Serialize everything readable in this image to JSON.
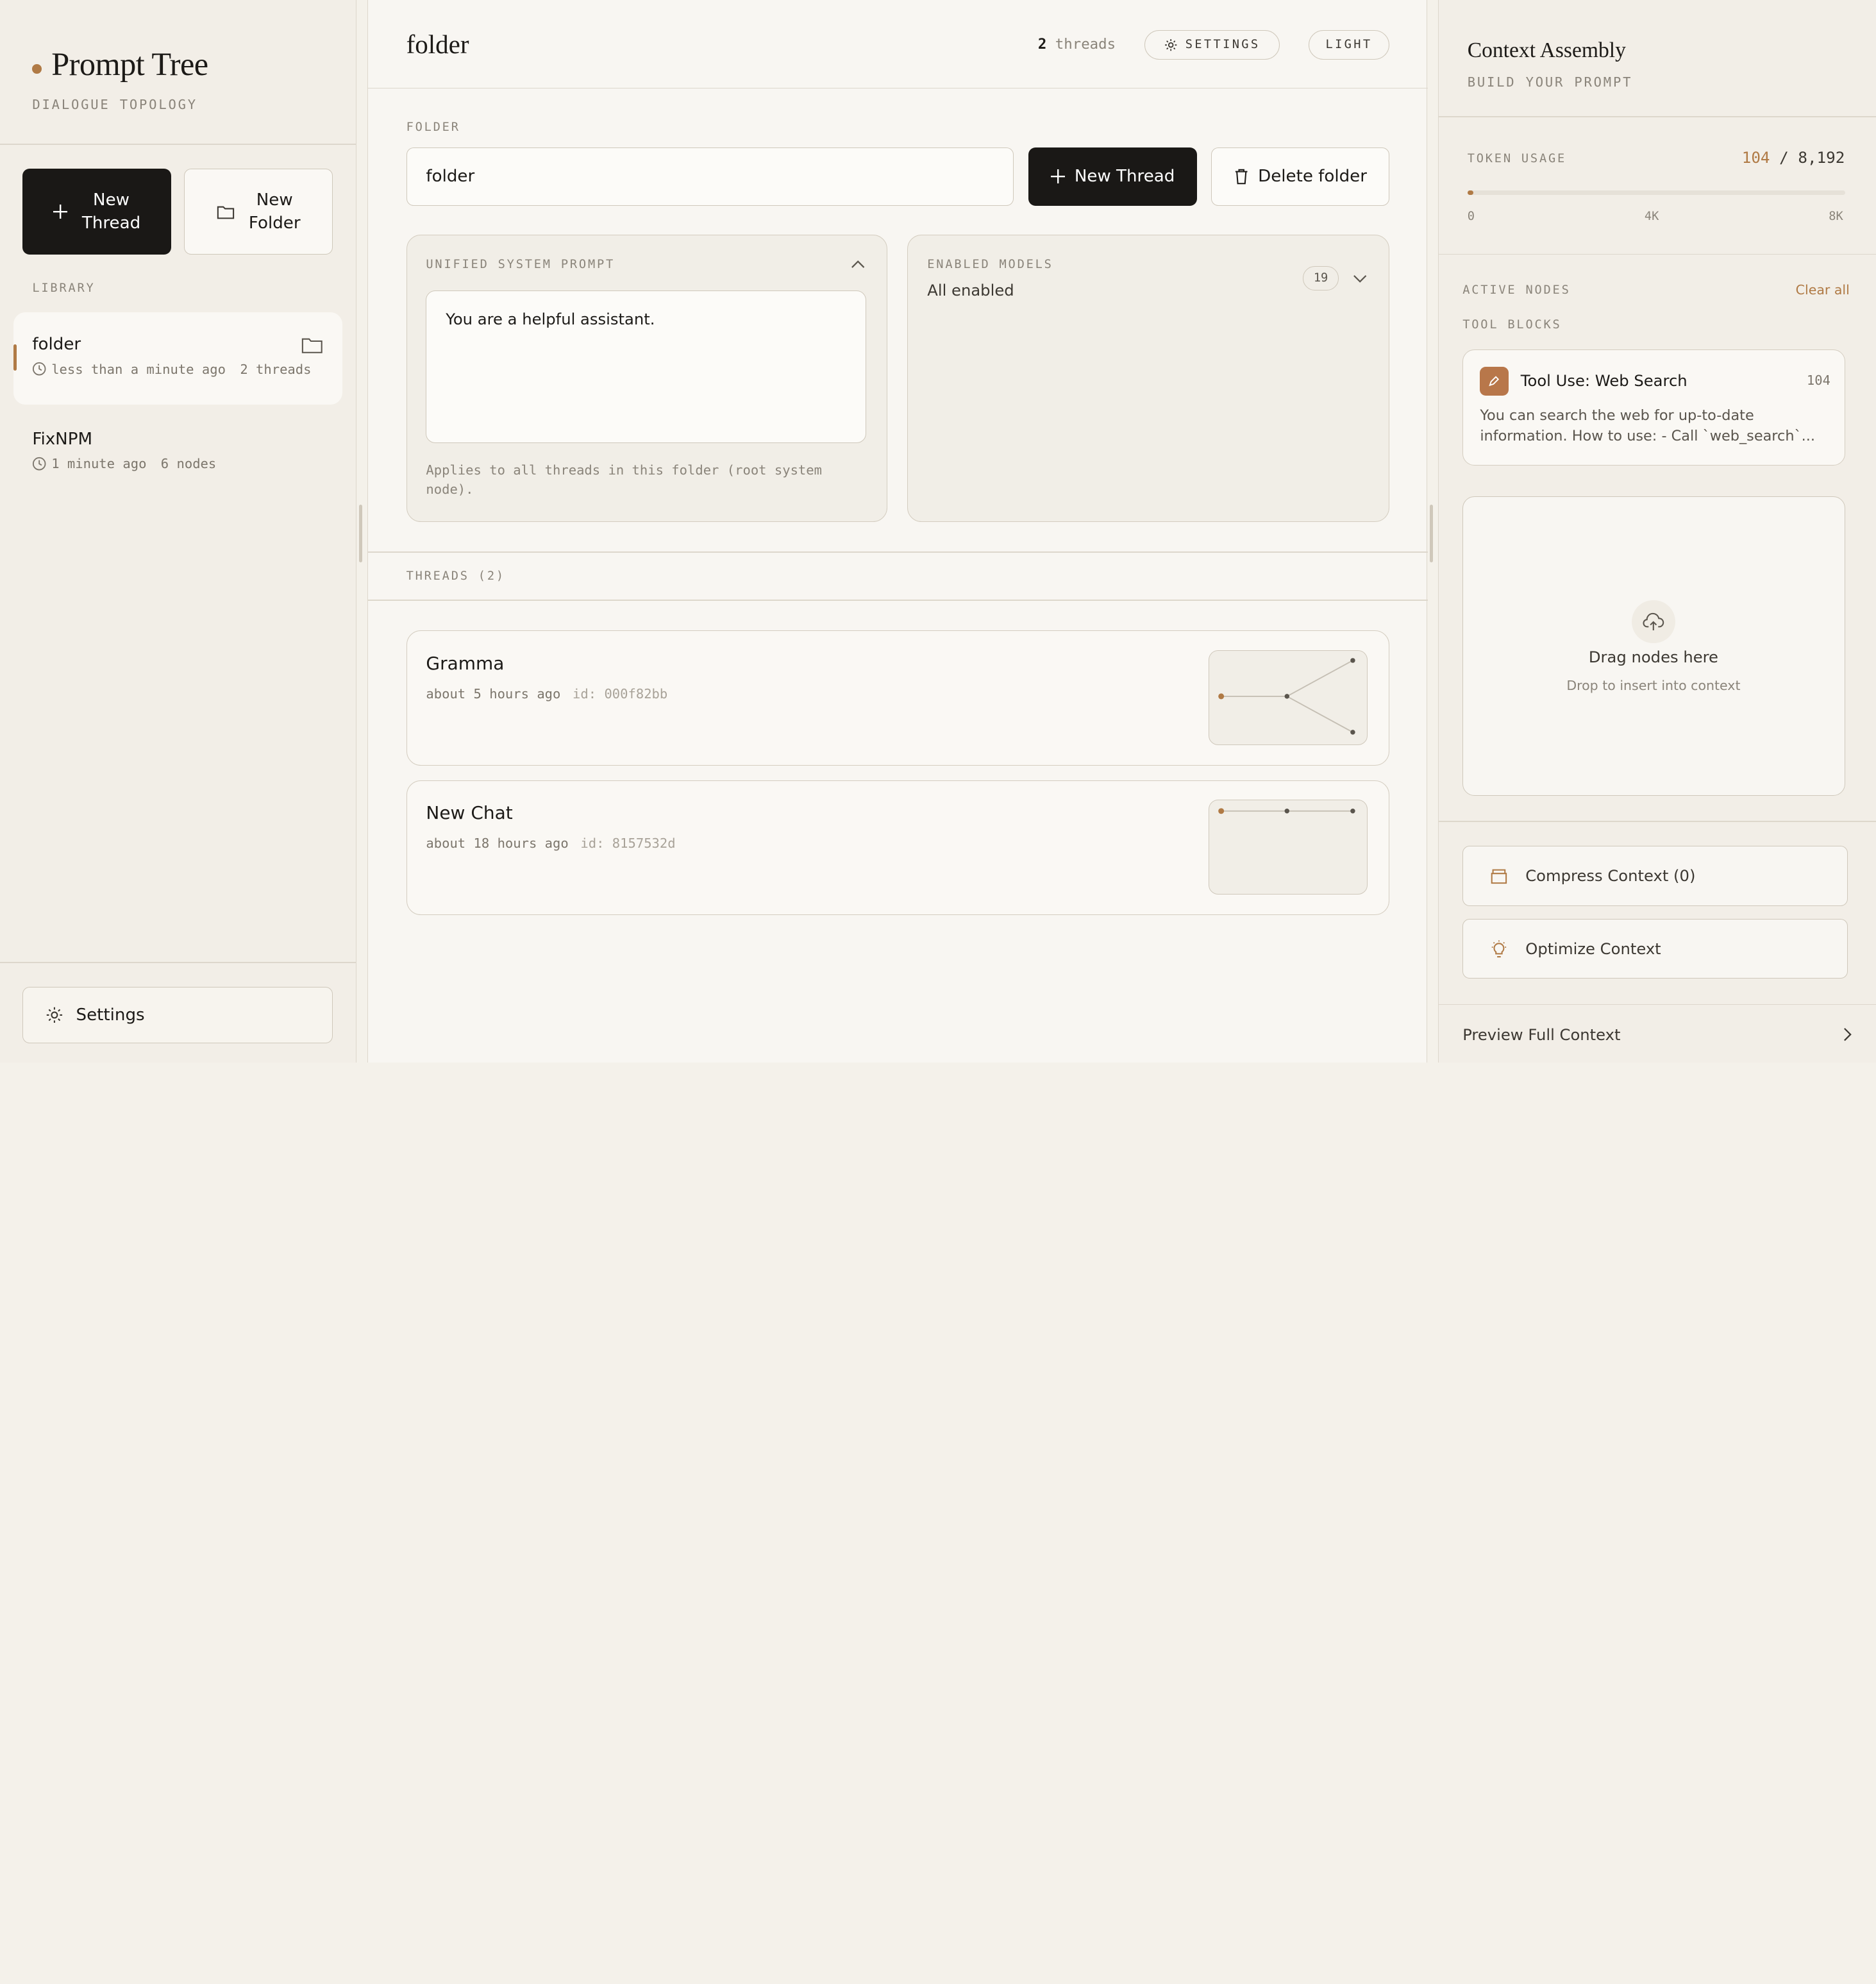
{
  "sidebar": {
    "brand_title": "Prompt Tree",
    "brand_subtitle": "DIALOGUE TOPOLOGY",
    "new_thread_label_1": "New",
    "new_thread_label_2": "Thread",
    "new_folder_label_1": "New",
    "new_folder_label_2": "Folder",
    "library_label": "LIBRARY",
    "items": [
      {
        "name": "folder",
        "time": "less than a minute ago",
        "count": "2 threads"
      },
      {
        "name": "FixNPM",
        "time": "1 minute ago",
        "count": "6 nodes"
      }
    ],
    "settings_label": "Settings"
  },
  "header": {
    "title": "folder",
    "thread_count_num": "2",
    "thread_count_text": "threads",
    "settings_label": "SETTINGS",
    "theme_label": "LIGHT"
  },
  "folder": {
    "label": "FOLDER",
    "name_value": "folder",
    "new_thread_label": "New Thread",
    "delete_label": "Delete folder"
  },
  "system_prompt": {
    "label": "UNIFIED SYSTEM PROMPT",
    "value": "You are a helpful assistant.",
    "hint": "Applies to all threads in this folder (root system node)."
  },
  "models": {
    "label": "ENABLED MODELS",
    "value": "All enabled",
    "count": "19"
  },
  "threads": {
    "label": "THREADS (2)",
    "items": [
      {
        "name": "Gramma",
        "time": "about 5 hours ago",
        "id": "id: 000f82bb"
      },
      {
        "name": "New Chat",
        "time": "about 18 hours ago",
        "id": "id: 8157532d"
      }
    ]
  },
  "context": {
    "title": "Context Assembly",
    "subtitle": "BUILD YOUR PROMPT",
    "token_label": "TOKEN USAGE",
    "token_used": "104",
    "token_sep": " / ",
    "token_max": "8,192",
    "token_fraction": 0.0127,
    "ticks": [
      "0",
      "4K",
      "8K"
    ],
    "active_label": "ACTIVE NODES",
    "clear_all": "Clear all",
    "tool_label": "TOOL BLOCKS",
    "tool": {
      "name": "Tool Use: Web Search",
      "count": "104",
      "desc": "You can search the web for up-to-date information. How to use: - Call `web_search`..."
    },
    "drop_title": "Drag nodes here",
    "drop_sub": "Drop to insert into context",
    "compress_label": "Compress Context (0)",
    "optimize_label": "Optimize Context",
    "preview_label": "Preview Full Context"
  },
  "colors": {
    "accent": "#b07a45",
    "dark": "#1a1816"
  }
}
